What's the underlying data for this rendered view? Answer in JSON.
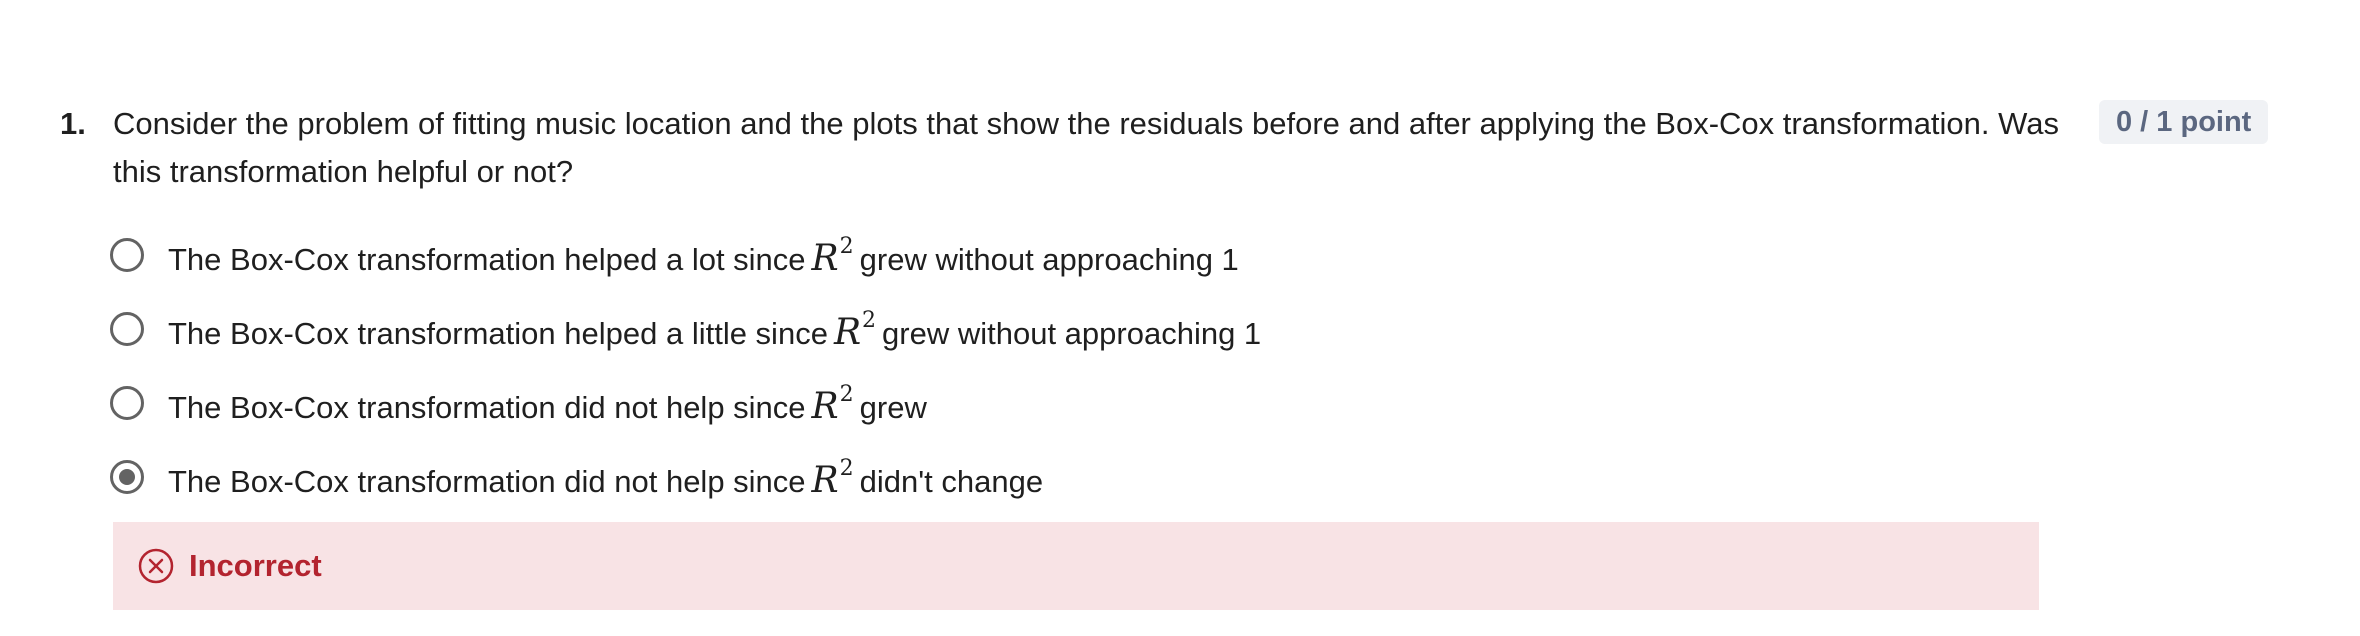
{
  "question": {
    "number": "1.",
    "text": "Consider the problem of fitting music location and the plots that show the residuals before and after applying the Box-Cox transformation. Was this transformation helpful or not?",
    "points": "0 / 1 point"
  },
  "options": [
    {
      "before": "The Box-Cox transformation helped a lot since",
      "math_symbol": "R",
      "math_exponent": "2",
      "after": "grew without approaching 1",
      "selected": false
    },
    {
      "before": "The Box-Cox transformation helped a little since",
      "math_symbol": "R",
      "math_exponent": "2",
      "after": "grew without approaching 1",
      "selected": false
    },
    {
      "before": "The Box-Cox transformation did not help since",
      "math_symbol": "R",
      "math_exponent": "2",
      "after": "grew",
      "selected": false
    },
    {
      "before": "The Box-Cox transformation did not help since",
      "math_symbol": "R",
      "math_exponent": "2",
      "after": "didn't change",
      "selected": true
    }
  ],
  "feedback": {
    "label": "Incorrect",
    "icon": "x-circle-icon",
    "color": "#b3242f",
    "background": "#f8e3e5"
  }
}
